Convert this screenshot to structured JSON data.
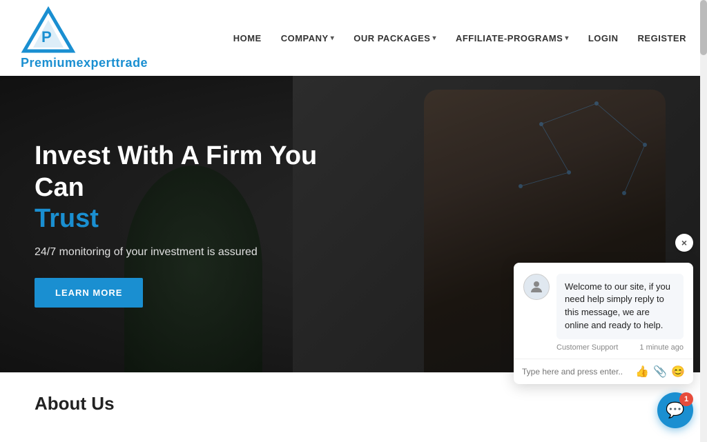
{
  "header": {
    "logo_text": "Premiumexperttrade",
    "nav": [
      {
        "id": "home",
        "label": "HOME",
        "has_dropdown": false
      },
      {
        "id": "company",
        "label": "COMPANY",
        "has_dropdown": true
      },
      {
        "id": "our-packages",
        "label": "OUR PACKAGES",
        "has_dropdown": true
      },
      {
        "id": "affiliate-programs",
        "label": "AFFILIATE-PROGRAMS",
        "has_dropdown": true
      },
      {
        "id": "login",
        "label": "LOGIN",
        "has_dropdown": false
      },
      {
        "id": "register",
        "label": "REGISTER",
        "has_dropdown": false
      }
    ]
  },
  "hero": {
    "title_line1": "Invest With A Firm You Can",
    "title_line2": "Trust",
    "subtitle": "24/7 monitoring of your investment is assured",
    "cta_label": "LEARN MORE"
  },
  "about": {
    "title": "About Us"
  },
  "chat": {
    "close_label": "×",
    "message": "Welcome to our site, if you need help simply reply to this message, we are online and ready to help.",
    "sender": "Customer Support",
    "time": "1 minute ago",
    "input_placeholder": "Type here and press enter..",
    "badge_count": "1"
  }
}
